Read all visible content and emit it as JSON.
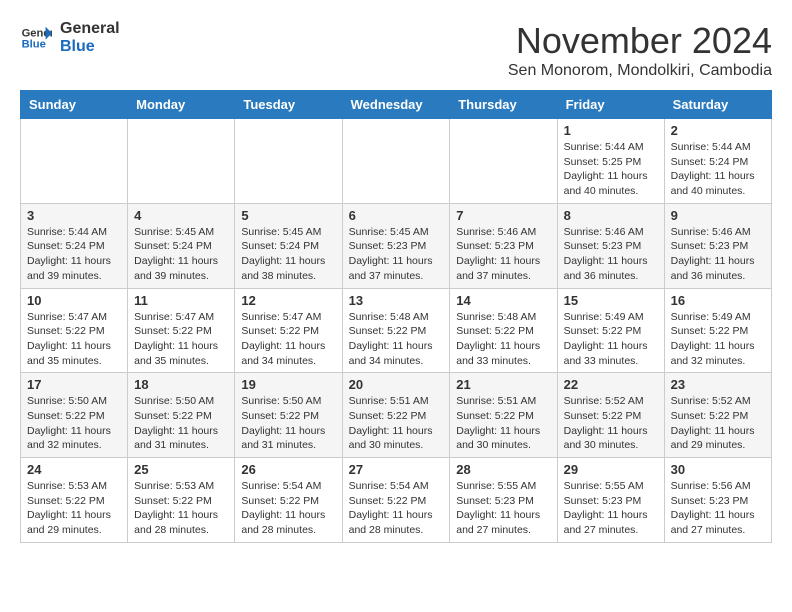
{
  "header": {
    "logo": {
      "line1": "General",
      "line2": "Blue"
    },
    "title": "November 2024",
    "subtitle": "Sen Monorom, Mondolkiri, Cambodia"
  },
  "weekdays": [
    "Sunday",
    "Monday",
    "Tuesday",
    "Wednesday",
    "Thursday",
    "Friday",
    "Saturday"
  ],
  "weeks": [
    [
      {
        "day": "",
        "info": ""
      },
      {
        "day": "",
        "info": ""
      },
      {
        "day": "",
        "info": ""
      },
      {
        "day": "",
        "info": ""
      },
      {
        "day": "",
        "info": ""
      },
      {
        "day": "1",
        "info": "Sunrise: 5:44 AM\nSunset: 5:25 PM\nDaylight: 11 hours and 40 minutes."
      },
      {
        "day": "2",
        "info": "Sunrise: 5:44 AM\nSunset: 5:24 PM\nDaylight: 11 hours and 40 minutes."
      }
    ],
    [
      {
        "day": "3",
        "info": "Sunrise: 5:44 AM\nSunset: 5:24 PM\nDaylight: 11 hours and 39 minutes."
      },
      {
        "day": "4",
        "info": "Sunrise: 5:45 AM\nSunset: 5:24 PM\nDaylight: 11 hours and 39 minutes."
      },
      {
        "day": "5",
        "info": "Sunrise: 5:45 AM\nSunset: 5:24 PM\nDaylight: 11 hours and 38 minutes."
      },
      {
        "day": "6",
        "info": "Sunrise: 5:45 AM\nSunset: 5:23 PM\nDaylight: 11 hours and 37 minutes."
      },
      {
        "day": "7",
        "info": "Sunrise: 5:46 AM\nSunset: 5:23 PM\nDaylight: 11 hours and 37 minutes."
      },
      {
        "day": "8",
        "info": "Sunrise: 5:46 AM\nSunset: 5:23 PM\nDaylight: 11 hours and 36 minutes."
      },
      {
        "day": "9",
        "info": "Sunrise: 5:46 AM\nSunset: 5:23 PM\nDaylight: 11 hours and 36 minutes."
      }
    ],
    [
      {
        "day": "10",
        "info": "Sunrise: 5:47 AM\nSunset: 5:22 PM\nDaylight: 11 hours and 35 minutes."
      },
      {
        "day": "11",
        "info": "Sunrise: 5:47 AM\nSunset: 5:22 PM\nDaylight: 11 hours and 35 minutes."
      },
      {
        "day": "12",
        "info": "Sunrise: 5:47 AM\nSunset: 5:22 PM\nDaylight: 11 hours and 34 minutes."
      },
      {
        "day": "13",
        "info": "Sunrise: 5:48 AM\nSunset: 5:22 PM\nDaylight: 11 hours and 34 minutes."
      },
      {
        "day": "14",
        "info": "Sunrise: 5:48 AM\nSunset: 5:22 PM\nDaylight: 11 hours and 33 minutes."
      },
      {
        "day": "15",
        "info": "Sunrise: 5:49 AM\nSunset: 5:22 PM\nDaylight: 11 hours and 33 minutes."
      },
      {
        "day": "16",
        "info": "Sunrise: 5:49 AM\nSunset: 5:22 PM\nDaylight: 11 hours and 32 minutes."
      }
    ],
    [
      {
        "day": "17",
        "info": "Sunrise: 5:50 AM\nSunset: 5:22 PM\nDaylight: 11 hours and 32 minutes."
      },
      {
        "day": "18",
        "info": "Sunrise: 5:50 AM\nSunset: 5:22 PM\nDaylight: 11 hours and 31 minutes."
      },
      {
        "day": "19",
        "info": "Sunrise: 5:50 AM\nSunset: 5:22 PM\nDaylight: 11 hours and 31 minutes."
      },
      {
        "day": "20",
        "info": "Sunrise: 5:51 AM\nSunset: 5:22 PM\nDaylight: 11 hours and 30 minutes."
      },
      {
        "day": "21",
        "info": "Sunrise: 5:51 AM\nSunset: 5:22 PM\nDaylight: 11 hours and 30 minutes."
      },
      {
        "day": "22",
        "info": "Sunrise: 5:52 AM\nSunset: 5:22 PM\nDaylight: 11 hours and 30 minutes."
      },
      {
        "day": "23",
        "info": "Sunrise: 5:52 AM\nSunset: 5:22 PM\nDaylight: 11 hours and 29 minutes."
      }
    ],
    [
      {
        "day": "24",
        "info": "Sunrise: 5:53 AM\nSunset: 5:22 PM\nDaylight: 11 hours and 29 minutes."
      },
      {
        "day": "25",
        "info": "Sunrise: 5:53 AM\nSunset: 5:22 PM\nDaylight: 11 hours and 28 minutes."
      },
      {
        "day": "26",
        "info": "Sunrise: 5:54 AM\nSunset: 5:22 PM\nDaylight: 11 hours and 28 minutes."
      },
      {
        "day": "27",
        "info": "Sunrise: 5:54 AM\nSunset: 5:22 PM\nDaylight: 11 hours and 28 minutes."
      },
      {
        "day": "28",
        "info": "Sunrise: 5:55 AM\nSunset: 5:23 PM\nDaylight: 11 hours and 27 minutes."
      },
      {
        "day": "29",
        "info": "Sunrise: 5:55 AM\nSunset: 5:23 PM\nDaylight: 11 hours and 27 minutes."
      },
      {
        "day": "30",
        "info": "Sunrise: 5:56 AM\nSunset: 5:23 PM\nDaylight: 11 hours and 27 minutes."
      }
    ]
  ]
}
